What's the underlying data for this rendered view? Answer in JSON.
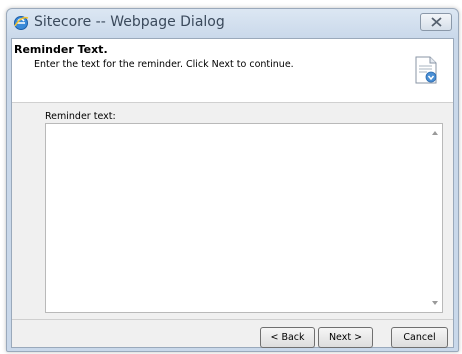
{
  "window": {
    "title": "Sitecore -- Webpage Dialog",
    "icon": "ie-icon"
  },
  "header": {
    "title": "Reminder Text.",
    "description": "Enter the text for the reminder. Click Next to continue.",
    "icon": "document-icon"
  },
  "form": {
    "label": "Reminder text:",
    "value": ""
  },
  "footer": {
    "back_label": "< Back",
    "next_label": "Next >",
    "cancel_label": "Cancel"
  },
  "colors": {
    "titlebar": "#c9d8ea",
    "client_bg": "#f0f0f0",
    "header_bg": "#ffffff"
  }
}
